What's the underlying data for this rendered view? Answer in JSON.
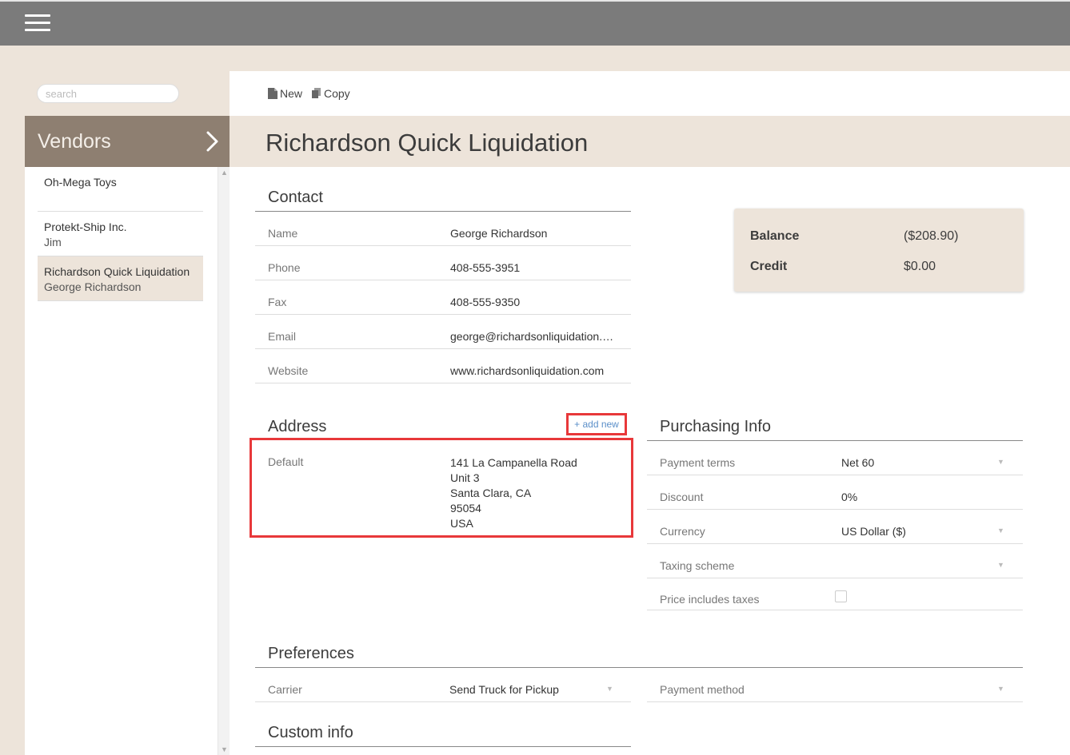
{
  "search": {
    "placeholder": "search"
  },
  "sidebar": {
    "title": "Vendors",
    "vendors": [
      {
        "name": "Oh-Mega Toys",
        "contact": ""
      },
      {
        "name": "Protekt-Ship Inc.",
        "contact": "Jim"
      },
      {
        "name": "Richardson Quick Liquidation",
        "contact": "George Richardson",
        "selected": true
      }
    ]
  },
  "toolbar": {
    "new_label": "New",
    "copy_label": "Copy"
  },
  "page": {
    "title": "Richardson Quick Liquidation"
  },
  "contact": {
    "title": "Contact",
    "rows": [
      {
        "label": "Name",
        "value": "George Richardson"
      },
      {
        "label": "Phone",
        "value": "408-555-3951"
      },
      {
        "label": "Fax",
        "value": "408-555-9350"
      },
      {
        "label": "Email",
        "value": "george@richardsonliquidation.com"
      },
      {
        "label": "Website",
        "value": "www.richardsonliquidation.com"
      }
    ]
  },
  "balance": {
    "balance_label": "Balance",
    "balance_value": "($208.90)",
    "credit_label": "Credit",
    "credit_value": "$0.00"
  },
  "address": {
    "title": "Address",
    "add_new_label": "+ add new",
    "label": "Default",
    "lines": [
      "141 La Campanella Road",
      "Unit 3",
      "Santa Clara, CA",
      "95054",
      "USA"
    ]
  },
  "purchasing": {
    "title": "Purchasing Info",
    "rows": [
      {
        "label": "Payment terms",
        "value": "Net 60"
      },
      {
        "label": "Discount",
        "value": "0%"
      },
      {
        "label": "Currency",
        "value": "US Dollar ($)"
      },
      {
        "label": "Taxing scheme",
        "value": ""
      },
      {
        "label": "Price includes taxes",
        "value": ""
      }
    ]
  },
  "preferences": {
    "title": "Preferences",
    "carrier_label": "Carrier",
    "carrier_value": "Send Truck for Pickup",
    "payment_method_label": "Payment method",
    "payment_method_value": ""
  },
  "custom_info": {
    "title": "Custom info"
  },
  "colors": {
    "topbar": "#7b7b7b",
    "sidebar_header": "#8e7f71",
    "background": "#ede4da",
    "highlight": "#e8383a",
    "link": "#5b8fc9"
  }
}
